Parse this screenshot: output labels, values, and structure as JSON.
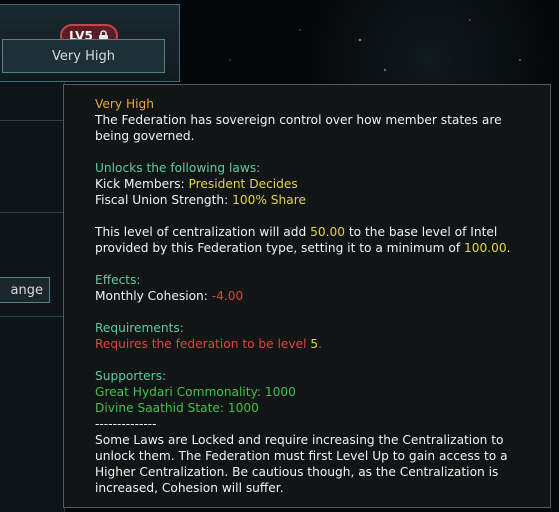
{
  "level_panel": {
    "badge": "LV5",
    "button_label": "Very High"
  },
  "left_panel": {
    "change_button_label": "ange"
  },
  "tooltip": {
    "title": "Very High",
    "description": "The Federation has sovereign control over how member states are being governed.",
    "unlocks_header": "Unlocks the following laws:",
    "laws": [
      {
        "name": "Kick Members:",
        "value": "President Decides"
      },
      {
        "name": "Fiscal Union Strength:",
        "value": "100% Share"
      }
    ],
    "intel": {
      "part1": "This level of centralization will add ",
      "value1": "50.00",
      "part2": " to the base level of Intel provided by this Federation type, setting it to a minimum of ",
      "value2": "100.00",
      "part3": "."
    },
    "effects_header": "Effects:",
    "effect": {
      "label": "Monthly Cohesion:",
      "value": "-4.00"
    },
    "requirements_header": "Requirements:",
    "requirement": {
      "text": "Requires the federation to be level ",
      "level": "5",
      "end": "."
    },
    "supporters_header": "Supporters:",
    "supporters": [
      "Great Hydari Commonality: 1000",
      "Divine Saathid State: 1000"
    ],
    "separator": "--------------",
    "footer": "Some Laws are Locked and require increasing the Centralization to unlock them. The Federation must first Level Up to gain access to a Higher Centralization. Be cautious though, as the Centralization is increased, Cohesion will suffer."
  },
  "colors": {
    "title": "#e3a838",
    "header": "#60c9a0",
    "highlight": "#e3d44a",
    "negative": "#e2453a",
    "supporter": "#42c24a"
  }
}
